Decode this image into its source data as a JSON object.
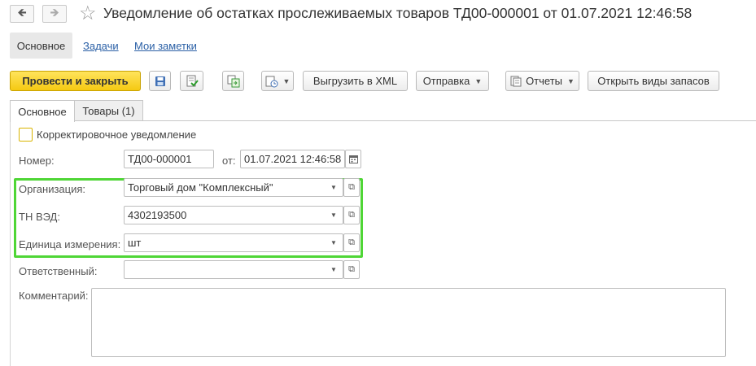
{
  "window": {
    "title": "Уведомление об остатках прослеживаемых товаров ТД00-000001 от 01.07.2021 12:46:58",
    "back_icon": "arrow-left-icon",
    "forward_icon": "arrow-right-icon",
    "favorite_icon": "star-icon"
  },
  "sections": [
    {
      "label": "Основное"
    },
    {
      "label": "Задачи"
    },
    {
      "label": "Мои заметки"
    }
  ],
  "toolbar": {
    "post_close_label": "Провести и закрыть",
    "save_icon": "save-icon",
    "post_icon": "post-icon",
    "related_icon": "related-documents-icon",
    "history_icon": "history-icon",
    "export_xml_label": "Выгрузить в XML",
    "send_label": "Отправка",
    "reports_label": "Отчеты",
    "open_stock_label": "Открыть виды запасов",
    "accent_color": "#f5c912"
  },
  "tabs": [
    {
      "label": "Основное"
    },
    {
      "label": "Товары (1)"
    }
  ],
  "form": {
    "correction_label": "Корректировочное уведомление",
    "number_label": "Номер:",
    "number_value": "ТД00-000001",
    "date_label": "от:",
    "date_value": "01.07.2021 12:46:58",
    "organization_label": "Организация:",
    "organization_value": "Торговый дом \"Комплексный\"",
    "tnved_label": "ТН ВЭД:",
    "tnved_value": "4302193500",
    "unit_label": "Единица измерения:",
    "unit_value": "шт",
    "responsible_label": "Ответственный:",
    "responsible_value": "",
    "comment_label": "Комментарий:",
    "comment_value": "",
    "highlight_color": "#4fd636"
  }
}
